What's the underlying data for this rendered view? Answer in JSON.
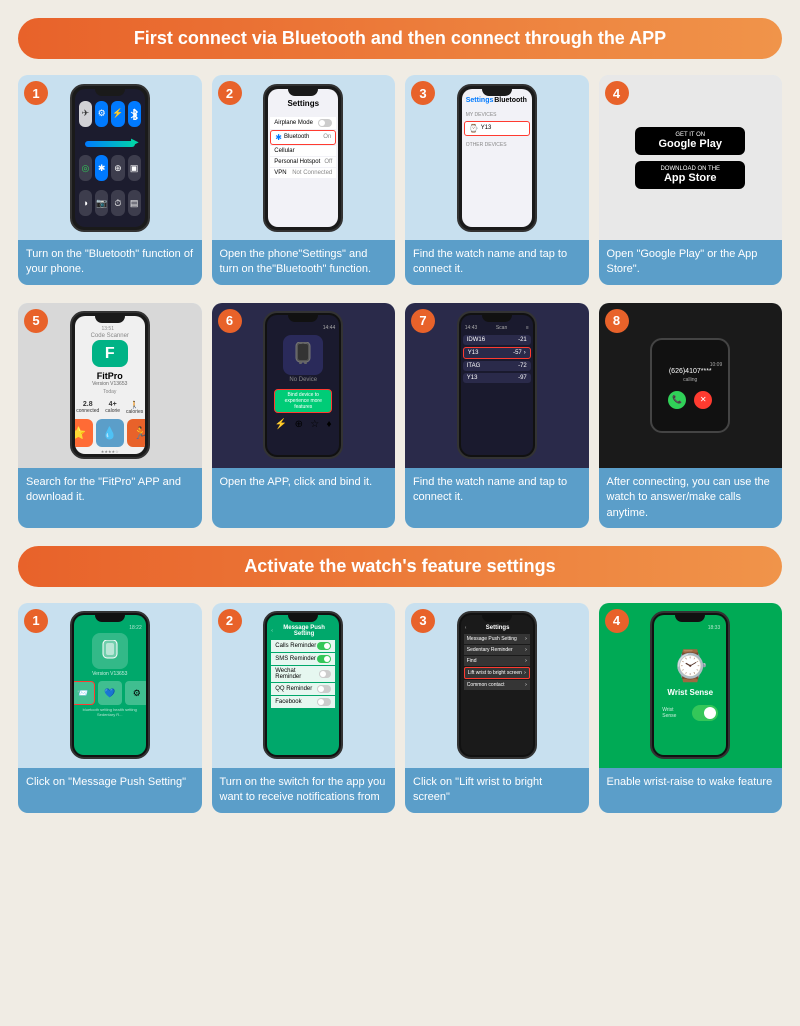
{
  "section1": {
    "header": "First connect via Bluetooth and then connect through the APP",
    "steps": [
      {
        "number": "1",
        "desc": "Turn on the \"Bluetooth\" function of your phone."
      },
      {
        "number": "2",
        "desc": "Open the phone\"Settings\" and turn on the\"Bluetooth\" function."
      },
      {
        "number": "3",
        "desc": "Find the watch name and tap to connect it."
      },
      {
        "number": "4",
        "desc": "Open \"Google Play\" or the App Store\"."
      },
      {
        "number": "5",
        "desc": "Search for the \"FitPro\" APP and download it."
      },
      {
        "number": "6",
        "desc": "Open the APP, click and bind it."
      },
      {
        "number": "7",
        "desc": "Find the watch name and tap to connect it."
      },
      {
        "number": "8",
        "desc": "After connecting, you can use the watch to answer/make calls anytime."
      }
    ],
    "step4": {
      "google_play_get": "GET IT ON",
      "google_play_name": "Google Play",
      "app_store_download": "Download on the",
      "app_store_name": "App Store"
    },
    "step2": {
      "title": "Settings",
      "airplane": "Airplane Mode",
      "bluetooth": "Bluetooth",
      "bluetooth_val": "On",
      "cellular": "Cellular",
      "hotspot": "Personal Hotspot",
      "hotspot_val": "Off",
      "vpn": "VPN",
      "vpn_val": "Not Connected"
    },
    "step3": {
      "back": "Settings",
      "title": "Bluetooth",
      "my_devices": "MY DEVICES",
      "device_name": "Y13"
    },
    "step5": {
      "app_name": "FitPro",
      "version": "Version V13653",
      "today": "Today"
    },
    "step6": {
      "no_device": "No Device",
      "bind_text": "Bind device to experience more features"
    },
    "step7": {
      "title": "Scan",
      "device1": "IDW16",
      "device1_rssi": "-21",
      "device2": "Y13",
      "device2_rssi": "-57",
      "device3": "ITAG",
      "device3_rssi": "-72",
      "device4": "Y13",
      "device4_rssi": "-97"
    },
    "step8": {
      "number": "(626)4107****",
      "label": "calling"
    }
  },
  "section2": {
    "header": "Activate the watch's feature settings",
    "steps": [
      {
        "number": "1",
        "desc": "Click on \"Message Push Setting\""
      },
      {
        "number": "2",
        "desc": "Turn on the switch for the app you want to receive notifications from"
      },
      {
        "number": "3",
        "desc": "Click on \"Lift wrist to bright screen\""
      },
      {
        "number": "4",
        "desc": "Enable wrist-raise to wake feature"
      }
    ],
    "step1": {
      "version": "Version V13653"
    },
    "step2": {
      "title": "Message Push Setting",
      "calls": "Calls Reminder",
      "sms": "SMS Reminder",
      "wechat": "Wechat Reminder",
      "qq": "QQ Reminder",
      "facebook": "Facebook"
    },
    "step3": {
      "msg_push": "Message Push Setting",
      "remote": "Sedentary Reminder",
      "find": "Find",
      "lift": "Lift wrist to bright screen",
      "common": "Common contact"
    },
    "step4": {
      "label": "Wrist Sense"
    }
  }
}
